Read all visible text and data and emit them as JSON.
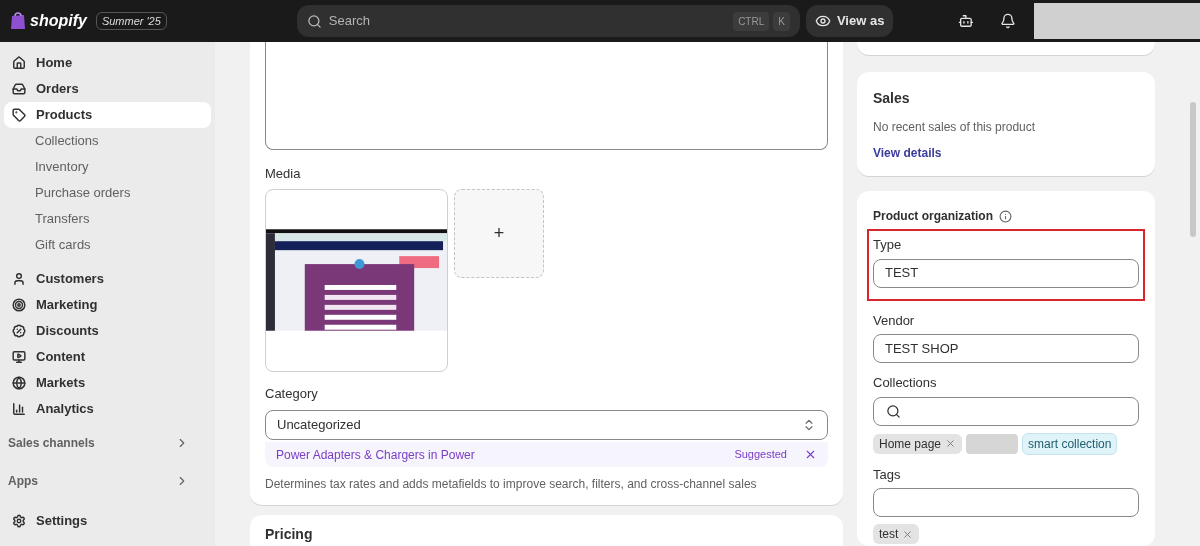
{
  "topbar": {
    "logo": "shopify",
    "badge": "Summer '25",
    "search": {
      "placeholder": "Search"
    },
    "shortcut": [
      "CTRL",
      "K"
    ],
    "view_as": "View as"
  },
  "sidebar": {
    "items": [
      {
        "label": "Home",
        "selected": false
      },
      {
        "label": "Orders",
        "selected": false
      },
      {
        "label": "Products",
        "selected": true,
        "children": [
          {
            "label": "Collections",
            "selected": false
          },
          {
            "label": "Inventory",
            "selected": false
          },
          {
            "label": "Purchase orders",
            "selected": false
          },
          {
            "label": "Transfers",
            "selected": false
          },
          {
            "label": "Gift cards",
            "selected": false
          }
        ]
      },
      {
        "label": "Customers",
        "selected": false
      },
      {
        "label": "Marketing",
        "selected": false
      },
      {
        "label": "Discounts",
        "selected": false
      },
      {
        "label": "Content",
        "selected": false
      },
      {
        "label": "Markets",
        "selected": false
      },
      {
        "label": "Analytics",
        "selected": false
      }
    ],
    "sections": [
      "Sales channels",
      "Apps"
    ],
    "settings": "Settings"
  },
  "main": {
    "media": {
      "label": "Media",
      "add": "+"
    },
    "category": {
      "label": "Category",
      "value": "Uncategorized",
      "suggestion": "Power Adapters & Chargers in Power",
      "suggested": "Suggested",
      "help": "Determines tax rates and adds metafields to improve search, filters, and cross-channel sales"
    },
    "pricing": {
      "title": "Pricing"
    }
  },
  "sales": {
    "title": "Sales",
    "text": "No recent sales of this product",
    "link": "View details"
  },
  "organization": {
    "title": "Product organization",
    "fields": [
      {
        "kind": "text",
        "label": "Type",
        "value": "TEST",
        "highlighted": true
      },
      {
        "kind": "text",
        "label": "Vendor",
        "value": "TEST SHOP",
        "highlighted": false
      },
      {
        "kind": "search",
        "label": "Collections",
        "highlighted": false,
        "chips": [
          {
            "kind": "manual",
            "label": "Home page"
          },
          {
            "kind": "redacted"
          },
          {
            "kind": "smart",
            "label": "smart collection"
          }
        ]
      },
      {
        "kind": "text",
        "label": "Tags",
        "highlighted": false,
        "chips": [
          {
            "kind": "manual",
            "label": "test"
          }
        ]
      }
    ]
  }
}
